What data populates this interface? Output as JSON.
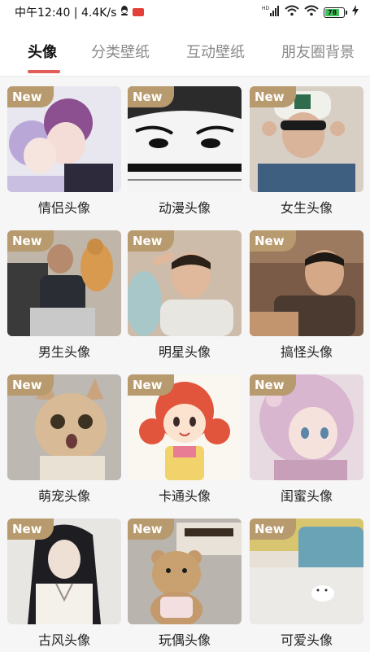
{
  "status_bar": {
    "carrier_time_speed": "中午12:40 | 4.4K/s",
    "battery_level": "78",
    "icons": [
      "qq-icon",
      "red-app-badge-icon",
      "hd-signal-icon",
      "wifi-icon",
      "wifi-icon",
      "battery-icon",
      "charging-icon"
    ]
  },
  "tabs": [
    {
      "label": "头像",
      "active": true
    },
    {
      "label": "分类壁纸",
      "active": false
    },
    {
      "label": "互动壁纸",
      "active": false
    },
    {
      "label": "朋友圈背景",
      "active": false
    }
  ],
  "colors": {
    "accent": "#e25d57",
    "badge": "#b79a6e"
  },
  "badge_label": "New",
  "cards": [
    {
      "label": "情侣头像",
      "badge": "New"
    },
    {
      "label": "动漫头像",
      "badge": "New"
    },
    {
      "label": "女生头像",
      "badge": "New"
    },
    {
      "label": "男生头像",
      "badge": "New"
    },
    {
      "label": "明星头像",
      "badge": "New"
    },
    {
      "label": "搞怪头像",
      "badge": "New"
    },
    {
      "label": "萌宠头像",
      "badge": "New"
    },
    {
      "label": "卡通头像",
      "badge": "New"
    },
    {
      "label": "闺蜜头像",
      "badge": "New"
    },
    {
      "label": "古风头像",
      "badge": "New"
    },
    {
      "label": "玩偶头像",
      "badge": "New"
    },
    {
      "label": "可爱头像",
      "badge": "New"
    }
  ]
}
